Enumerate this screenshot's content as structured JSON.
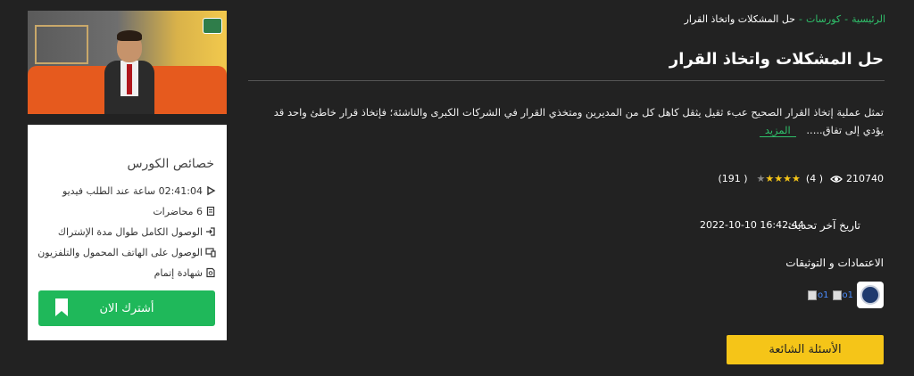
{
  "breadcrumb": {
    "items": [
      "الرئيسية",
      "كورسات"
    ],
    "current": "حل المشكلات واتخاذ القرار",
    "separator": "-"
  },
  "course": {
    "title": "حل المشكلات واتخاذ القرار",
    "description": "تمثل عملية إتخاذ القرار الصحيح عبء ثقيل يثقل كاهل كل من المديرين ومتخذي القرار في الشركات الكبرى والناشئة؛ فإتخاذ قرار خاطئ واحد قد يؤدي إلى تفاق.....",
    "more_label": "المزيد",
    "views": "210740",
    "ratings_count": "( 4)",
    "rating_votes": "( 191)",
    "rating": 4,
    "rating_max": 5,
    "updated_label": "تاريخ آخر تحديث",
    "updated_value": "2022-10-10 16:42:44"
  },
  "features": {
    "title": "خصائص الكورس",
    "items": [
      {
        "icon": "play-icon",
        "text": "02:41:04 ساعة عند الطلب فيديو"
      },
      {
        "icon": "document-icon",
        "text": "6 محاضرات"
      },
      {
        "icon": "sign-in-icon",
        "text": "الوصول الكامل طوال مدة الإشتراك"
      },
      {
        "icon": "devices-icon",
        "text": "الوصول على الهاتف المحمول والتلفزيون"
      },
      {
        "icon": "certificate-icon",
        "text": "شهادة إتمام"
      }
    ],
    "subscribe_label": "أشترك الان"
  },
  "accreditations": {
    "title": "الاعتمادات و التوثيقات",
    "broken_label_1": "o1",
    "broken_label_2": "o1"
  },
  "faq_label": "الأسئلة الشائعة",
  "colors": {
    "background": "#222222",
    "accent_green": "#1fb85a",
    "link_green": "#2fbf6a",
    "star": "#f5c518",
    "faq_button": "#f5c518"
  }
}
